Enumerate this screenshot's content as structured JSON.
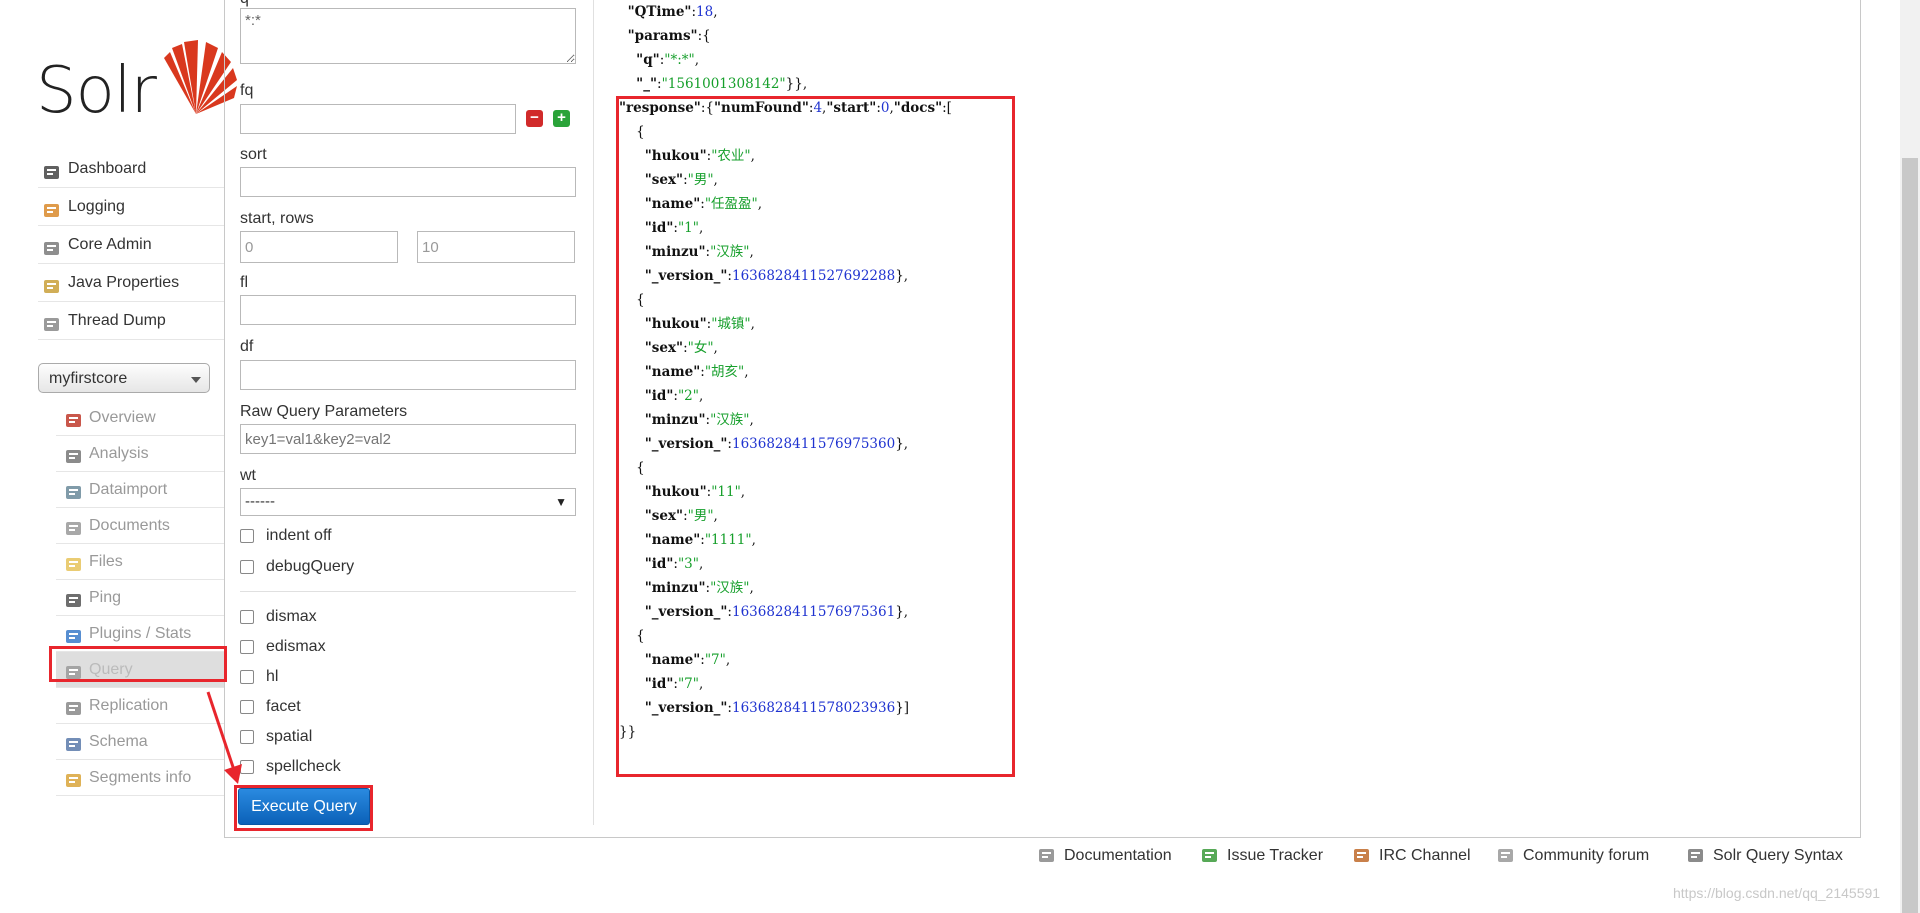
{
  "brand": {
    "logo_text": "Solr",
    "accent": "#d9381e"
  },
  "nav": {
    "items": [
      {
        "label": "Dashboard",
        "icon": "dashboard-icon"
      },
      {
        "label": "Logging",
        "icon": "logging-icon"
      },
      {
        "label": "Core Admin",
        "icon": "core-admin-icon"
      },
      {
        "label": "Java Properties",
        "icon": "java-icon"
      },
      {
        "label": "Thread Dump",
        "icon": "thread-dump-icon"
      }
    ]
  },
  "core_selector": {
    "value": "myfirstcore"
  },
  "core_nav": {
    "items": [
      {
        "label": "Overview",
        "icon": "home-icon"
      },
      {
        "label": "Analysis",
        "icon": "funnel-icon"
      },
      {
        "label": "Dataimport",
        "icon": "dataimport-icon"
      },
      {
        "label": "Documents",
        "icon": "documents-icon"
      },
      {
        "label": "Files",
        "icon": "folder-icon"
      },
      {
        "label": "Ping",
        "icon": "ping-icon"
      },
      {
        "label": "Plugins / Stats",
        "icon": "plugins-icon"
      },
      {
        "label": "Query",
        "icon": "query-icon"
      },
      {
        "label": "Replication",
        "icon": "replication-icon"
      },
      {
        "label": "Schema",
        "icon": "schema-icon"
      },
      {
        "label": "Segments info",
        "icon": "segments-icon"
      }
    ],
    "active": "Query"
  },
  "form": {
    "q_label": "q",
    "q_value": "*:*",
    "fq_label": "fq",
    "fq_value": "",
    "sort_label": "sort",
    "sort_value": "",
    "start_rows_label": "start, rows",
    "start_value": "0",
    "rows_value": "10",
    "fl_label": "fl",
    "fl_value": "",
    "df_label": "df",
    "df_value": "",
    "raw_label": "Raw Query Parameters",
    "raw_placeholder": "key1=val1&key2=val2",
    "wt_label": "wt",
    "wt_value": "------",
    "indent_label": "indent off",
    "debug_label": "debugQuery",
    "dismax_label": "dismax",
    "edismax_label": "edismax",
    "hl_label": "hl",
    "facet_label": "facet",
    "spatial_label": "spatial",
    "spellcheck_label": "spellcheck",
    "execute_label": "Execute Query"
  },
  "response": {
    "lines": [
      "  \"QTime\":18,",
      "  \"params\":{",
      "    \"q\":\"*:*\",",
      "    \"_\":\"1561001308142\"}},",
      "\"response\":{\"numFound\":4,\"start\":0,\"docs\":[",
      "    {",
      "      \"hukou\":\"农业\",",
      "      \"sex\":\"男\",",
      "      \"name\":\"任盈盈\",",
      "      \"id\":\"1\",",
      "      \"minzu\":\"汉族\",",
      "      \"_version_\":1636828411527692288},",
      "    {",
      "      \"hukou\":\"城镇\",",
      "      \"sex\":\"女\",",
      "      \"name\":\"胡亥\",",
      "      \"id\":\"2\",",
      "      \"minzu\":\"汉族\",",
      "      \"_version_\":1636828411576975360},",
      "    {",
      "      \"hukou\":\"11\",",
      "      \"sex\":\"男\",",
      "      \"name\":\"1111\",",
      "      \"id\":\"3\",",
      "      \"minzu\":\"汉族\",",
      "      \"_version_\":1636828411576975361},",
      "    {",
      "      \"name\":\"7\",",
      "      \"id\":\"7\",",
      "      \"_version_\":1636828411578023936}]",
      "}}"
    ]
  },
  "footer": {
    "links": [
      {
        "label": "Documentation",
        "icon": "documentation-icon"
      },
      {
        "label": "Issue Tracker",
        "icon": "bug-icon"
      },
      {
        "label": "IRC Channel",
        "icon": "irc-icon"
      },
      {
        "label": "Community forum",
        "icon": "mail-icon"
      },
      {
        "label": "Solr Query Syntax",
        "icon": "syntax-icon"
      }
    ]
  },
  "watermark": "https://blog.csdn.net/qq_2145591",
  "annotation_color": "#e8262d"
}
